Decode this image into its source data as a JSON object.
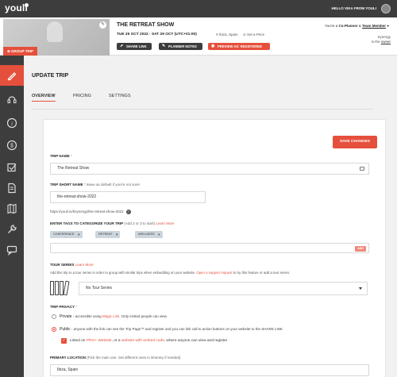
{
  "topbar": {
    "logo": "youli",
    "greeting": "HELLO VIKA FROM YOULI"
  },
  "header": {
    "group_trip_label": "GROUP TRIP",
    "title": "THE RETREAT SHOW",
    "dates": "TUE 25 OCT 2022 - SAT 29 OCT (UTC+01:00)",
    "location": "Ibiza, Spain",
    "price": "Set a Price",
    "buttons": {
      "share": "SHARE LINK",
      "notes": "PLANNER NOTES",
      "preview": "PREVIEW AS: REGISTERED"
    },
    "role_prefix": "You're a",
    "role_coplanner": "Co-Planner",
    "role_amp": "&",
    "role_team": "Team Member",
    "owner_name": "Synergy",
    "owner_is": "is the",
    "owner_link": "owner"
  },
  "main": {
    "title": "UPDATE TRIP",
    "tabs": [
      "OVERVIEW",
      "PRICING",
      "SETTINGS"
    ],
    "save_label": "SAVE CHANGES"
  },
  "form": {
    "trip_name_label": "TRIP NAME",
    "required_mark": "*",
    "trip_name_value": "The Retreat Show",
    "short_name_label": "TRIP SHORT NAME",
    "short_name_hint": "leave as default if you're not sure!",
    "short_name_value": "the-retreat-show-2022",
    "short_url": "https://youli.io/t/synergy/the-retreat-show-2022",
    "tags_label": "ENTER TAGS TO CATEGORIZE YOUR TRIP",
    "tags_hint": "(Add 2 or 3 to start)",
    "learn_more": "Learn More",
    "tags": [
      "CONFERENCE",
      "RETREAT",
      "WELLNESS"
    ],
    "add_label": "ADD",
    "tour_series_label": "TOUR SERIES",
    "tour_series_help_1": "Add this trip to a tour series in order to group with similar trips when embedding on your website.",
    "tour_series_help_link": "Open a support request",
    "tour_series_help_2": "to try this feature or add a tour series.",
    "tour_series_value": "No Tour Series",
    "privacy_label": "TRIP PRIVACY",
    "private_title": "Private",
    "private_desc_1": "- accessible using",
    "private_desc_link": "Magic Link",
    "private_desc_2": ". Only invited people can view",
    "public_title": "Public",
    "public_desc": "- anyone with the link can see the Trip Page™ and register and you can link call to action buttons on your website to the SHARE LINK",
    "listed_1": "Listed on",
    "listed_link1": "PRO+ Website",
    "listed_2": ", or a",
    "listed_link2": "website with embed code",
    "listed_3": ", where anyone can view and register",
    "location_label": "PRIMARY LOCATION",
    "location_hint": "(Pick the main one. Set different ones in itinerary if needed)",
    "location_value": "Ibiza, Spain"
  },
  "colors": {
    "accent": "#e5503c",
    "dark": "#3d3d3d",
    "tag_bg": "#cdd6dd"
  }
}
